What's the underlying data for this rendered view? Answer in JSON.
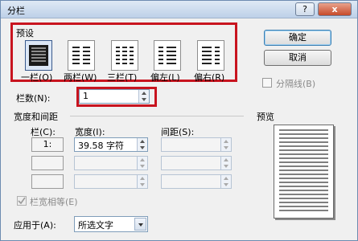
{
  "window": {
    "title": "分栏",
    "help": "?",
    "close": "x"
  },
  "presets": {
    "title": "预设",
    "items": [
      {
        "label": "一栏(O)",
        "icon": "one-column-icon",
        "selected": true
      },
      {
        "label": "两栏(W)",
        "icon": "two-columns-icon",
        "selected": false
      },
      {
        "label": "三栏(T)",
        "icon": "three-columns-icon",
        "selected": false
      },
      {
        "label": "偏左(L)",
        "icon": "left-columns-icon",
        "selected": false
      },
      {
        "label": "偏右(R)",
        "icon": "right-columns-icon",
        "selected": false
      }
    ]
  },
  "buttons": {
    "ok": "确定",
    "cancel": "取消"
  },
  "separator": {
    "label": "分隔线(B)",
    "checked": false
  },
  "columns": {
    "label": "栏数(N):",
    "value": "1"
  },
  "width_spacing": {
    "title": "宽度和间距",
    "col_header": "栏(C):",
    "width_header": "宽度(I):",
    "spacing_header": "间距(S):",
    "rows": [
      {
        "num": "1:",
        "width": "39.58 字符",
        "spacing": ""
      },
      {
        "num": "",
        "width": "",
        "spacing": ""
      },
      {
        "num": "",
        "width": "",
        "spacing": ""
      }
    ],
    "equal_width": {
      "label": "栏宽相等(E)",
      "checked": true
    }
  },
  "preview": {
    "title": "预览"
  },
  "apply_to": {
    "label": "应用于(A):",
    "value": "所选文字"
  }
}
